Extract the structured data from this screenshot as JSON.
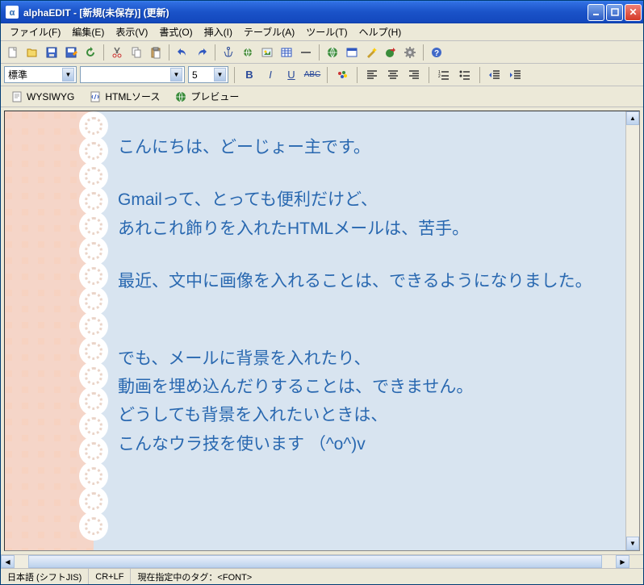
{
  "title": "alphaEDIT - [新規(未保存)] (更新)",
  "menu": {
    "file": "ファイル(F)",
    "edit": "編集(E)",
    "view": "表示(V)",
    "format": "書式(O)",
    "insert": "挿入(I)",
    "table": "テーブル(A)",
    "tools": "ツール(T)",
    "help": "ヘルプ(H)"
  },
  "format_combo": {
    "style": "標準",
    "font": "",
    "size": "5"
  },
  "view_tabs": {
    "wysiwyg": "WYSIWYG",
    "html": "HTMLソース",
    "preview": "プレビュー"
  },
  "document": {
    "p1": "こんにちは、どーじょー主です。",
    "p2": "Gmailって、とっても便利だけど、",
    "p3": "あれこれ飾りを入れたHTMLメールは、苦手。",
    "p4": "最近、文中に画像を入れることは、できるようになりました。",
    "p5": "でも、メールに背景を入れたり、",
    "p6": "動画を埋め込んだりすることは、できません。",
    "p7": "どうしても背景を入れたいときは、",
    "p8": "こんなウラ技を使います （^o^)v"
  },
  "status": {
    "encoding": "日本語 (シフトJIS)",
    "lineend": "CR+LF",
    "tag": "現在指定中のタグ：<FONT>"
  }
}
